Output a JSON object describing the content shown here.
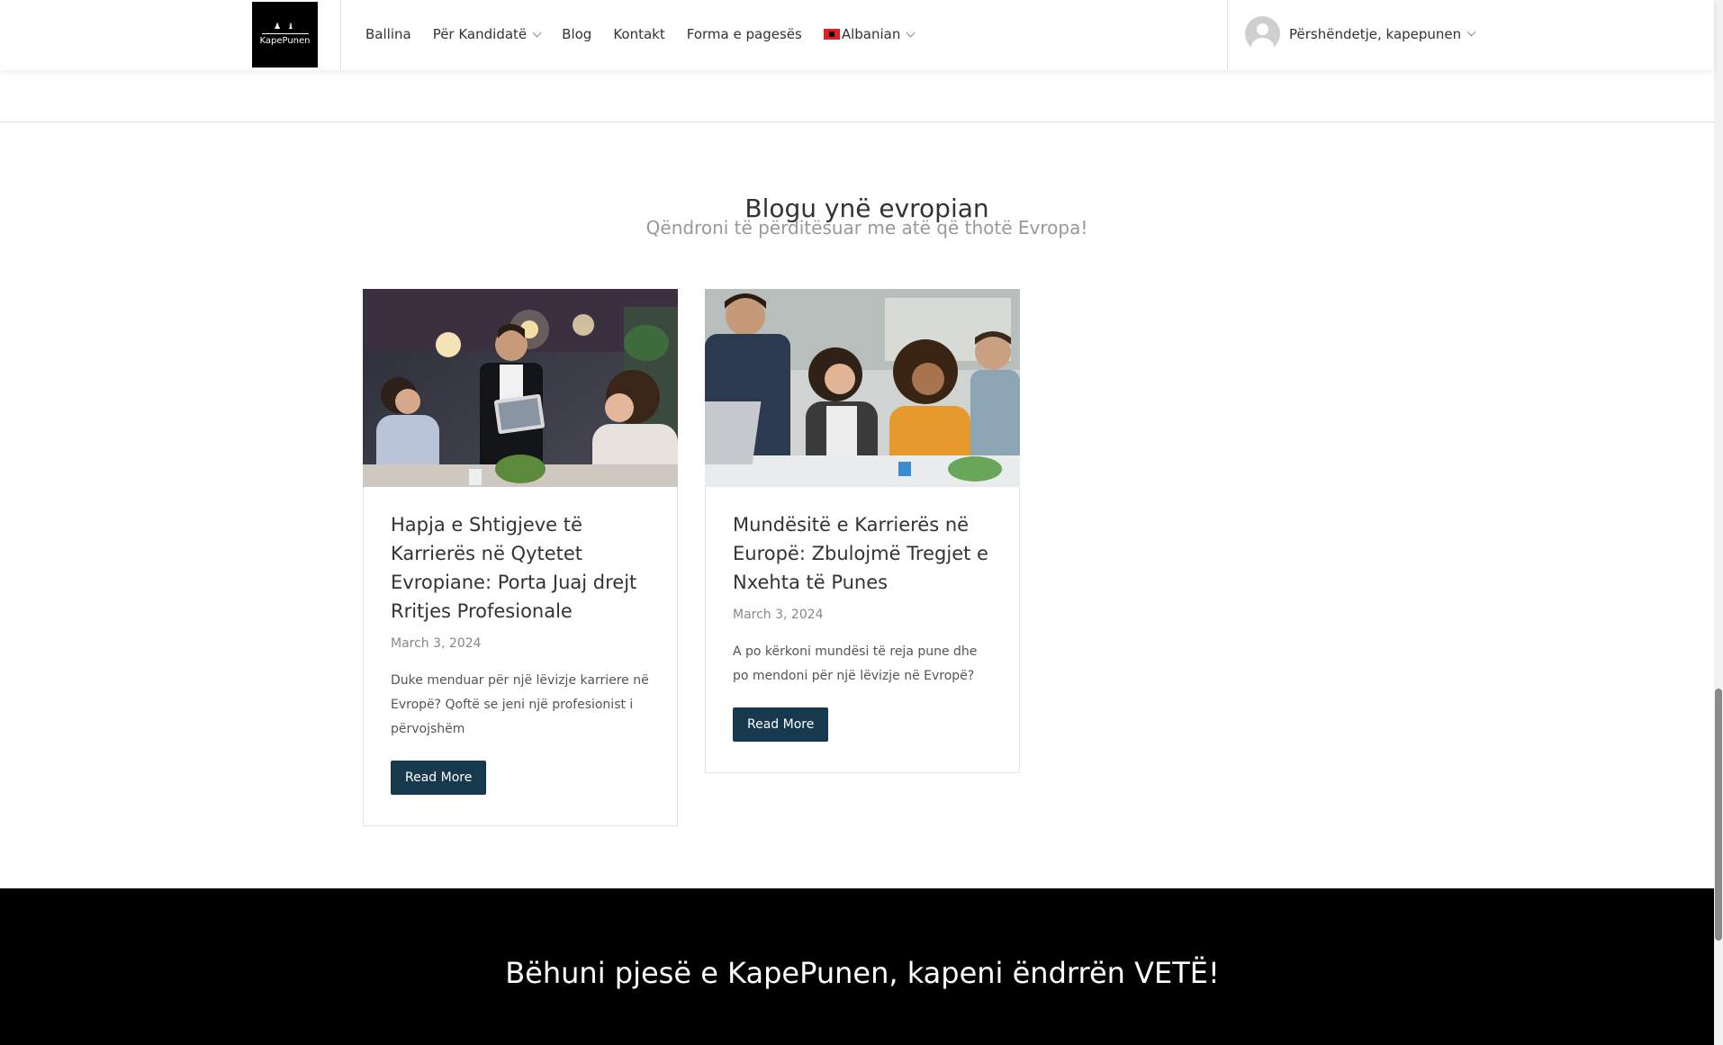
{
  "header": {
    "logo_text": "KapePunen",
    "nav": [
      {
        "label": "Ballina",
        "has_dropdown": false
      },
      {
        "label": "Për Kandidatë",
        "has_dropdown": true
      },
      {
        "label": "Blog",
        "has_dropdown": false
      },
      {
        "label": "Kontakt",
        "has_dropdown": false
      },
      {
        "label": "Forma e pagesës",
        "has_dropdown": false
      }
    ],
    "language": "Albanian",
    "greeting": "Përshëndetje, kapepunen"
  },
  "section": {
    "title": "Blogu ynë evropian",
    "subtitle": "Qëndroni të përditësuar me atë që thotë Evropa!"
  },
  "posts": [
    {
      "title": "Hapja e Shtigjeve të Karrierës në Qytetet Evropiane: Porta Juaj drejt Rritjes Profesionale",
      "date": "March 3, 2024",
      "excerpt": "Duke menduar për një lëvizje karriere në Evropë? Qoftë se jeni një profesionist i përvojshëm",
      "button": "Read More"
    },
    {
      "title": "Mundësitë e Karrierës në Europë: Zbulojmë Tregjet e Nxehta të Punes",
      "date": "March 3, 2024",
      "excerpt": "A po kërkoni mundësi të reja pune dhe po mendoni për një lëvizje në Evropë?",
      "button": "Read More"
    }
  ],
  "cta": {
    "text": "Bëhuni pjesë e KapePunen, kapeni ëndrrën VETË!"
  },
  "colors": {
    "button": "#17394d",
    "cta_background": "#000000"
  }
}
